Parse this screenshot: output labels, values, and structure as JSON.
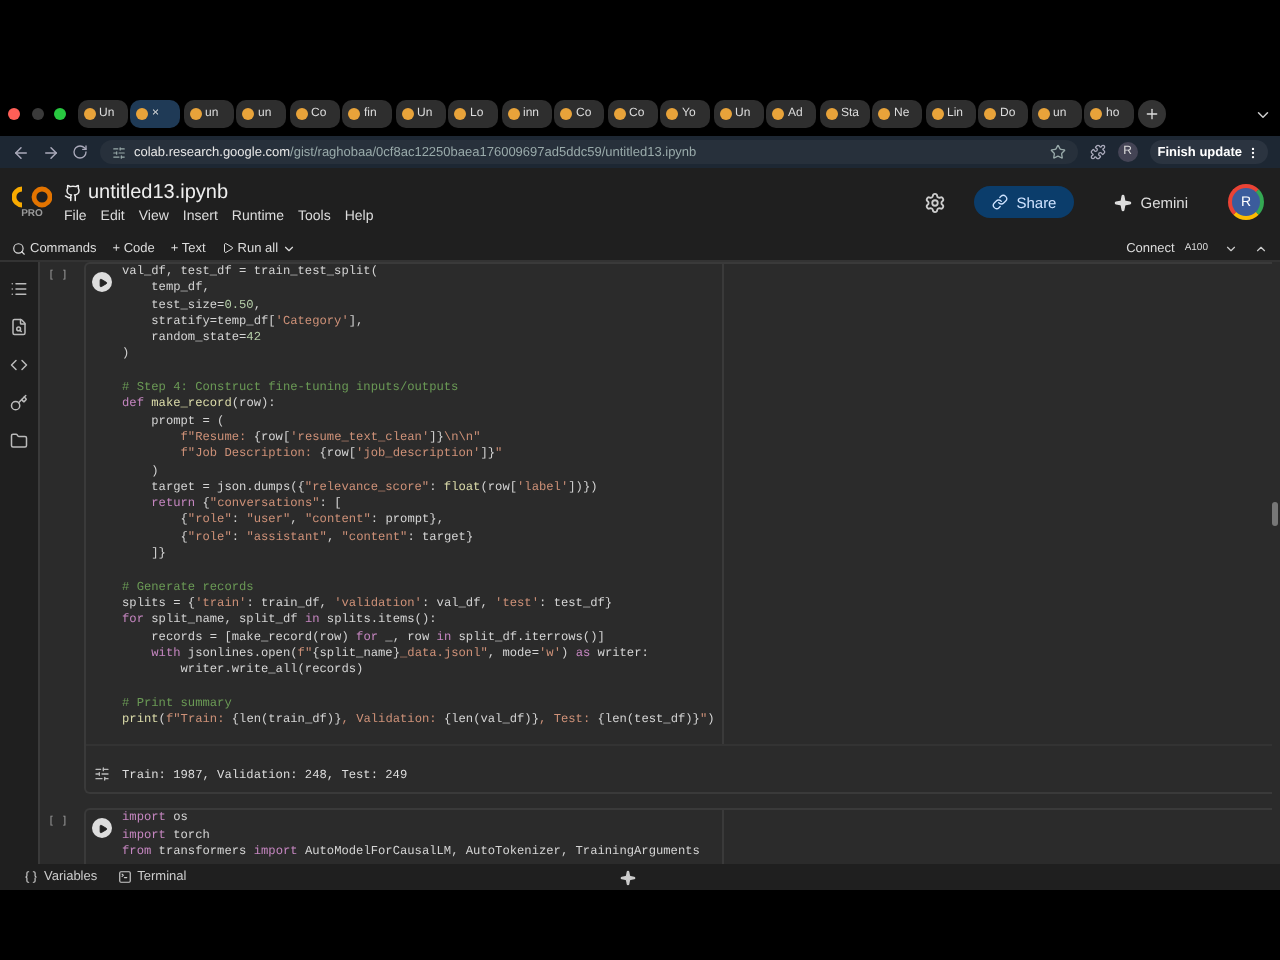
{
  "browser": {
    "tabs": [
      {
        "label": "Un",
        "selected": false
      },
      {
        "label": "×",
        "selected": true
      },
      {
        "label": "un",
        "selected": false
      },
      {
        "label": "un",
        "selected": false
      },
      {
        "label": "Co",
        "selected": false
      },
      {
        "label": "fin",
        "selected": false
      },
      {
        "label": "Un",
        "selected": false
      },
      {
        "label": "Lo",
        "selected": false
      },
      {
        "label": "inn",
        "selected": false
      },
      {
        "label": "Co",
        "selected": false
      },
      {
        "label": "Co",
        "selected": false
      },
      {
        "label": "Yo",
        "selected": false
      },
      {
        "label": "Un",
        "selected": false
      },
      {
        "label": "Ad",
        "selected": false
      },
      {
        "label": "Sta",
        "selected": false
      },
      {
        "label": "Ne",
        "selected": false
      },
      {
        "label": "Lin",
        "selected": false
      },
      {
        "label": "Do",
        "selected": false
      },
      {
        "label": "un",
        "selected": false
      },
      {
        "label": "ho",
        "selected": false
      }
    ],
    "url_domain": "colab.research.google.com",
    "url_path": "/gist/raghobaa/0cf8ac12250baea176009697ad5ddc59/untitled13.ipynb",
    "profile": "R",
    "update_button": "Finish update"
  },
  "header": {
    "logo_badge": "PRO",
    "title": "untitled13.ipynb",
    "menu": [
      "File",
      "Edit",
      "View",
      "Insert",
      "Runtime",
      "Tools",
      "Help"
    ],
    "share": "Share",
    "gemini": "Gemini",
    "avatar": "R"
  },
  "toolbar": {
    "commands": "Commands",
    "code": "+ Code",
    "text": "+ Text",
    "run_all": "Run all",
    "connect": "Connect",
    "runtime": "A100"
  },
  "cells": [
    {
      "bracket": "[ ]",
      "lines": [
        {
          "kind": "code",
          "seg": [
            {
              "kind": "p",
              "text": "val_df, test_df = train_test_split("
            }
          ]
        },
        {
          "kind": "code",
          "seg": [
            {
              "kind": "p",
              "text": "    temp_df,"
            }
          ]
        },
        {
          "kind": "code",
          "seg": [
            {
              "kind": "p",
              "text": "    test_size="
            },
            {
              "kind": "n",
              "text": "0.50"
            },
            {
              "kind": "p",
              "text": ","
            }
          ]
        },
        {
          "kind": "code",
          "seg": [
            {
              "kind": "p",
              "text": "    stratify=temp_df["
            },
            {
              "kind": "s",
              "text": "'Category'"
            },
            {
              "kind": "p",
              "text": "],"
            }
          ]
        },
        {
          "kind": "code",
          "seg": [
            {
              "kind": "p",
              "text": "    random_state="
            },
            {
              "kind": "n",
              "text": "42"
            }
          ]
        },
        {
          "kind": "code",
          "seg": [
            {
              "kind": "p",
              "text": ")"
            }
          ]
        },
        {
          "kind": "blank"
        },
        {
          "kind": "code",
          "seg": [
            {
              "kind": "c",
              "text": "# Step 4: Construct fine-tuning inputs/outputs"
            }
          ]
        },
        {
          "kind": "code",
          "seg": [
            {
              "kind": "k",
              "text": "def "
            },
            {
              "kind": "f",
              "text": "make_record"
            },
            {
              "kind": "p",
              "text": "(row):"
            }
          ]
        },
        {
          "kind": "code",
          "seg": [
            {
              "kind": "p",
              "text": "    prompt = ("
            }
          ]
        },
        {
          "kind": "code",
          "seg": [
            {
              "kind": "s",
              "text": "        f\"Resume: "
            },
            {
              "kind": "p",
              "text": "{row["
            },
            {
              "kind": "s",
              "text": "'resume_text_clean'"
            },
            {
              "kind": "p",
              "text": "]}"
            },
            {
              "kind": "s",
              "text": "\\n\\n\""
            }
          ]
        },
        {
          "kind": "code",
          "seg": [
            {
              "kind": "s",
              "text": "        f\"Job Description: "
            },
            {
              "kind": "p",
              "text": "{row["
            },
            {
              "kind": "s",
              "text": "'job_description'"
            },
            {
              "kind": "p",
              "text": "]}"
            },
            {
              "kind": "s",
              "text": "\""
            }
          ]
        },
        {
          "kind": "code",
          "seg": [
            {
              "kind": "p",
              "text": "    )"
            }
          ]
        },
        {
          "kind": "code",
          "seg": [
            {
              "kind": "p",
              "text": "    target = json.dumps({"
            },
            {
              "kind": "s",
              "text": "\"relevance_score\""
            },
            {
              "kind": "p",
              "text": ": "
            },
            {
              "kind": "f",
              "text": "float"
            },
            {
              "kind": "p",
              "text": "(row["
            },
            {
              "kind": "s",
              "text": "'label'"
            },
            {
              "kind": "p",
              "text": "])})"
            }
          ]
        },
        {
          "kind": "code",
          "seg": [
            {
              "kind": "k",
              "text": "    return "
            },
            {
              "kind": "p",
              "text": "{"
            },
            {
              "kind": "s",
              "text": "\"conversations\""
            },
            {
              "kind": "p",
              "text": ": ["
            }
          ]
        },
        {
          "kind": "code",
          "seg": [
            {
              "kind": "p",
              "text": "        {"
            },
            {
              "kind": "s",
              "text": "\"role\""
            },
            {
              "kind": "p",
              "text": ": "
            },
            {
              "kind": "s",
              "text": "\"user\""
            },
            {
              "kind": "p",
              "text": ", "
            },
            {
              "kind": "s",
              "text": "\"content\""
            },
            {
              "kind": "p",
              "text": ": prompt},"
            }
          ]
        },
        {
          "kind": "code",
          "seg": [
            {
              "kind": "p",
              "text": "        {"
            },
            {
              "kind": "s",
              "text": "\"role\""
            },
            {
              "kind": "p",
              "text": ": "
            },
            {
              "kind": "s",
              "text": "\"assistant\""
            },
            {
              "kind": "p",
              "text": ", "
            },
            {
              "kind": "s",
              "text": "\"content\""
            },
            {
              "kind": "p",
              "text": ": target}"
            }
          ]
        },
        {
          "kind": "code",
          "seg": [
            {
              "kind": "p",
              "text": "    ]}"
            }
          ]
        },
        {
          "kind": "blank"
        },
        {
          "kind": "code",
          "seg": [
            {
              "kind": "c",
              "text": "# Generate records"
            }
          ]
        },
        {
          "kind": "code",
          "seg": [
            {
              "kind": "p",
              "text": "splits = {"
            },
            {
              "kind": "s",
              "text": "'train'"
            },
            {
              "kind": "p",
              "text": ": train_df, "
            },
            {
              "kind": "s",
              "text": "'validation'"
            },
            {
              "kind": "p",
              "text": ": val_df, "
            },
            {
              "kind": "s",
              "text": "'test'"
            },
            {
              "kind": "p",
              "text": ": test_df}"
            }
          ]
        },
        {
          "kind": "code",
          "seg": [
            {
              "kind": "k",
              "text": "for "
            },
            {
              "kind": "p",
              "text": "split_name, split_df "
            },
            {
              "kind": "k",
              "text": "in "
            },
            {
              "kind": "p",
              "text": "splits.items():"
            }
          ]
        },
        {
          "kind": "code",
          "seg": [
            {
              "kind": "p",
              "text": "    records = [make_record(row) "
            },
            {
              "kind": "k",
              "text": "for "
            },
            {
              "kind": "p",
              "text": "_, row "
            },
            {
              "kind": "k",
              "text": "in "
            },
            {
              "kind": "p",
              "text": "split_df.iterrows()]"
            }
          ]
        },
        {
          "kind": "code",
          "seg": [
            {
              "kind": "k",
              "text": "    with "
            },
            {
              "kind": "p",
              "text": "jsonlines.open("
            },
            {
              "kind": "s",
              "text": "f\""
            },
            {
              "kind": "p",
              "text": "{split_name}"
            },
            {
              "kind": "s",
              "text": "_data.jsonl\""
            },
            {
              "kind": "p",
              "text": ", mode="
            },
            {
              "kind": "s",
              "text": "'w'"
            },
            {
              "kind": "p",
              "text": ") "
            },
            {
              "kind": "k",
              "text": "as "
            },
            {
              "kind": "p",
              "text": "writer:"
            }
          ]
        },
        {
          "kind": "code",
          "seg": [
            {
              "kind": "p",
              "text": "        writer.write_all(records)"
            }
          ]
        },
        {
          "kind": "blank"
        },
        {
          "kind": "code",
          "seg": [
            {
              "kind": "c",
              "text": "# Print summary"
            }
          ]
        },
        {
          "kind": "code",
          "seg": [
            {
              "kind": "f",
              "text": "print"
            },
            {
              "kind": "p",
              "text": "("
            },
            {
              "kind": "s",
              "text": "f\"Train: "
            },
            {
              "kind": "p",
              "text": "{len(train_df)}"
            },
            {
              "kind": "s",
              "text": ", Validation: "
            },
            {
              "kind": "p",
              "text": "{len(val_df)}"
            },
            {
              "kind": "s",
              "text": ", Test: "
            },
            {
              "kind": "p",
              "text": "{len(test_df)}"
            },
            {
              "kind": "s",
              "text": "\""
            },
            {
              "kind": "p",
              "text": ")"
            }
          ]
        }
      ],
      "output": "Train: 1987, Validation: 248, Test: 249"
    },
    {
      "bracket": "[ ]",
      "lines": [
        {
          "kind": "code",
          "seg": [
            {
              "kind": "k",
              "text": "import "
            },
            {
              "kind": "p",
              "text": "os"
            }
          ]
        },
        {
          "kind": "code",
          "seg": [
            {
              "kind": "k",
              "text": "import "
            },
            {
              "kind": "p",
              "text": "torch"
            }
          ]
        },
        {
          "kind": "code",
          "seg": [
            {
              "kind": "k",
              "text": "from "
            },
            {
              "kind": "p",
              "text": "transformers "
            },
            {
              "kind": "k",
              "text": "import "
            },
            {
              "kind": "p",
              "text": "AutoModelForCausalLM, AutoTokenizer, TrainingArguments"
            }
          ]
        }
      ]
    }
  ],
  "status_bar": {
    "variables": "Variables",
    "terminal": "Terminal"
  }
}
